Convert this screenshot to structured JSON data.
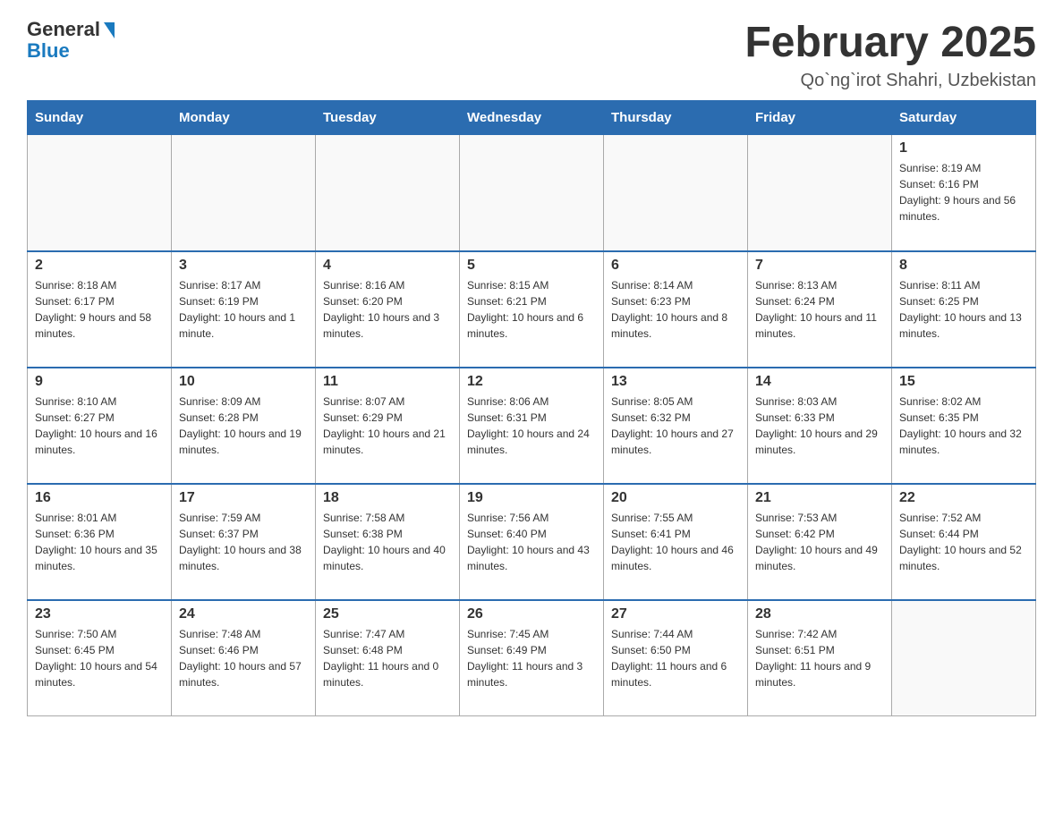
{
  "header": {
    "logo_general": "General",
    "logo_blue": "Blue",
    "title": "February 2025",
    "subtitle": "Qo`ng`irot Shahri, Uzbekistan"
  },
  "days_of_week": [
    "Sunday",
    "Monday",
    "Tuesday",
    "Wednesday",
    "Thursday",
    "Friday",
    "Saturday"
  ],
  "weeks": [
    {
      "days": [
        {
          "number": "",
          "info": ""
        },
        {
          "number": "",
          "info": ""
        },
        {
          "number": "",
          "info": ""
        },
        {
          "number": "",
          "info": ""
        },
        {
          "number": "",
          "info": ""
        },
        {
          "number": "",
          "info": ""
        },
        {
          "number": "1",
          "info": "Sunrise: 8:19 AM\nSunset: 6:16 PM\nDaylight: 9 hours and 56 minutes."
        }
      ]
    },
    {
      "days": [
        {
          "number": "2",
          "info": "Sunrise: 8:18 AM\nSunset: 6:17 PM\nDaylight: 9 hours and 58 minutes."
        },
        {
          "number": "3",
          "info": "Sunrise: 8:17 AM\nSunset: 6:19 PM\nDaylight: 10 hours and 1 minute."
        },
        {
          "number": "4",
          "info": "Sunrise: 8:16 AM\nSunset: 6:20 PM\nDaylight: 10 hours and 3 minutes."
        },
        {
          "number": "5",
          "info": "Sunrise: 8:15 AM\nSunset: 6:21 PM\nDaylight: 10 hours and 6 minutes."
        },
        {
          "number": "6",
          "info": "Sunrise: 8:14 AM\nSunset: 6:23 PM\nDaylight: 10 hours and 8 minutes."
        },
        {
          "number": "7",
          "info": "Sunrise: 8:13 AM\nSunset: 6:24 PM\nDaylight: 10 hours and 11 minutes."
        },
        {
          "number": "8",
          "info": "Sunrise: 8:11 AM\nSunset: 6:25 PM\nDaylight: 10 hours and 13 minutes."
        }
      ]
    },
    {
      "days": [
        {
          "number": "9",
          "info": "Sunrise: 8:10 AM\nSunset: 6:27 PM\nDaylight: 10 hours and 16 minutes."
        },
        {
          "number": "10",
          "info": "Sunrise: 8:09 AM\nSunset: 6:28 PM\nDaylight: 10 hours and 19 minutes."
        },
        {
          "number": "11",
          "info": "Sunrise: 8:07 AM\nSunset: 6:29 PM\nDaylight: 10 hours and 21 minutes."
        },
        {
          "number": "12",
          "info": "Sunrise: 8:06 AM\nSunset: 6:31 PM\nDaylight: 10 hours and 24 minutes."
        },
        {
          "number": "13",
          "info": "Sunrise: 8:05 AM\nSunset: 6:32 PM\nDaylight: 10 hours and 27 minutes."
        },
        {
          "number": "14",
          "info": "Sunrise: 8:03 AM\nSunset: 6:33 PM\nDaylight: 10 hours and 29 minutes."
        },
        {
          "number": "15",
          "info": "Sunrise: 8:02 AM\nSunset: 6:35 PM\nDaylight: 10 hours and 32 minutes."
        }
      ]
    },
    {
      "days": [
        {
          "number": "16",
          "info": "Sunrise: 8:01 AM\nSunset: 6:36 PM\nDaylight: 10 hours and 35 minutes."
        },
        {
          "number": "17",
          "info": "Sunrise: 7:59 AM\nSunset: 6:37 PM\nDaylight: 10 hours and 38 minutes."
        },
        {
          "number": "18",
          "info": "Sunrise: 7:58 AM\nSunset: 6:38 PM\nDaylight: 10 hours and 40 minutes."
        },
        {
          "number": "19",
          "info": "Sunrise: 7:56 AM\nSunset: 6:40 PM\nDaylight: 10 hours and 43 minutes."
        },
        {
          "number": "20",
          "info": "Sunrise: 7:55 AM\nSunset: 6:41 PM\nDaylight: 10 hours and 46 minutes."
        },
        {
          "number": "21",
          "info": "Sunrise: 7:53 AM\nSunset: 6:42 PM\nDaylight: 10 hours and 49 minutes."
        },
        {
          "number": "22",
          "info": "Sunrise: 7:52 AM\nSunset: 6:44 PM\nDaylight: 10 hours and 52 minutes."
        }
      ]
    },
    {
      "days": [
        {
          "number": "23",
          "info": "Sunrise: 7:50 AM\nSunset: 6:45 PM\nDaylight: 10 hours and 54 minutes."
        },
        {
          "number": "24",
          "info": "Sunrise: 7:48 AM\nSunset: 6:46 PM\nDaylight: 10 hours and 57 minutes."
        },
        {
          "number": "25",
          "info": "Sunrise: 7:47 AM\nSunset: 6:48 PM\nDaylight: 11 hours and 0 minutes."
        },
        {
          "number": "26",
          "info": "Sunrise: 7:45 AM\nSunset: 6:49 PM\nDaylight: 11 hours and 3 minutes."
        },
        {
          "number": "27",
          "info": "Sunrise: 7:44 AM\nSunset: 6:50 PM\nDaylight: 11 hours and 6 minutes."
        },
        {
          "number": "28",
          "info": "Sunrise: 7:42 AM\nSunset: 6:51 PM\nDaylight: 11 hours and 9 minutes."
        },
        {
          "number": "",
          "info": ""
        }
      ]
    }
  ]
}
